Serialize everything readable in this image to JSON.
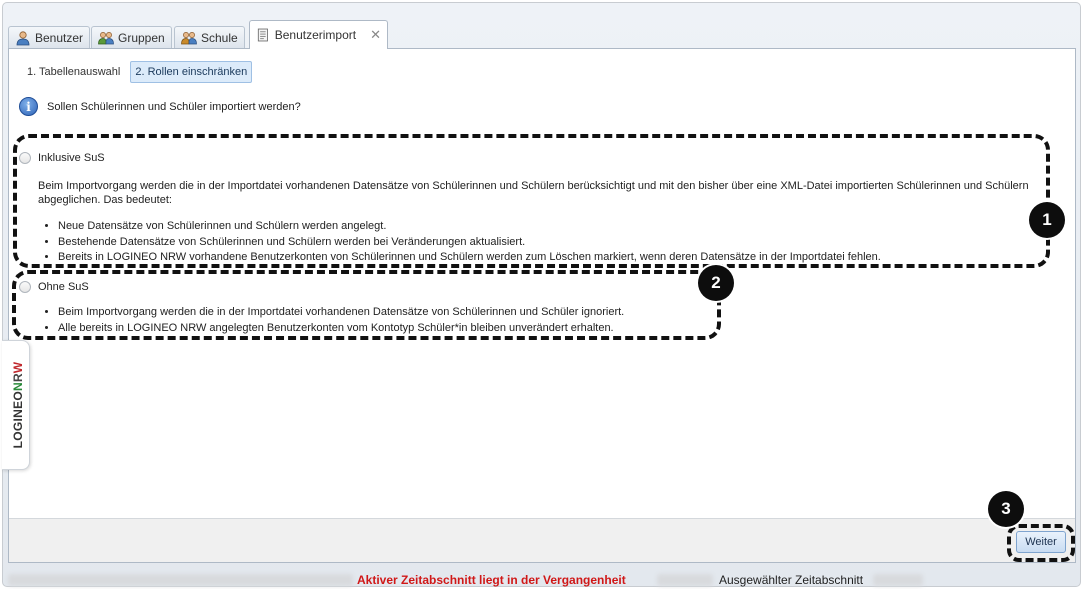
{
  "tabs": [
    {
      "label": "Benutzer",
      "icon": "user-icon"
    },
    {
      "label": "Gruppen",
      "icon": "group-icon"
    },
    {
      "label": "Schule",
      "icon": "school-icon"
    },
    {
      "label": "Benutzerimport",
      "icon": "import-icon",
      "active": true,
      "closable": true
    }
  ],
  "steps": {
    "step1": "1. Tabellenauswahl",
    "step2": "2. Rollen einschränken"
  },
  "question": "Sollen Schülerinnen und Schüler importiert werden?",
  "option_inklusive": {
    "label": "Inklusive SuS",
    "description": "Beim Importvorgang werden die in der Importdatei vorhandenen Datensätze von Schülerinnen und Schülern berücksichtigt und mit den bisher über eine XML-Datei importierten Schülerinnen und Schülern abgeglichen. Das bedeutet:",
    "bullets": [
      "Neue Datensätze von Schülerinnen und Schülern werden angelegt.",
      "Bestehende Datensätze von Schülerinnen und Schülern werden bei Veränderungen aktualisiert.",
      "Bereits in LOGINEO NRW vorhandene Benutzerkonten von Schülerinnen und Schülern werden zum Löschen markiert, wenn deren Datensätze in der Importdatei fehlen."
    ]
  },
  "option_ohne": {
    "label": "Ohne SuS",
    "bullets": [
      "Beim Importvorgang werden die in der Importdatei vorhandenen Datensätze von Schülerinnen und Schüler ignoriert.",
      "Alle bereits in LOGINEO NRW angelegten Benutzerkonten vom Kontotyp Schüler*in bleiben unverändert erhalten."
    ]
  },
  "markers": [
    "1",
    "2",
    "3"
  ],
  "side_logo": {
    "part1": "LOGINEO",
    "n": "N",
    "r": "R",
    "w": "W"
  },
  "buttons": {
    "weiter": "Weiter"
  },
  "status": {
    "warning": "Aktiver Zeitabschnitt liegt in der Vergangenheit",
    "selected_label": "Ausgewählter Zeitabschnitt"
  },
  "colors": {
    "warning": "#d01818",
    "accent": "#2d62b6"
  }
}
